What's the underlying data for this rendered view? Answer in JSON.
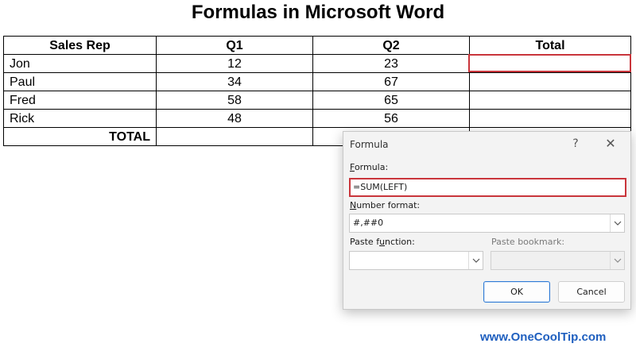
{
  "page": {
    "title": "Formulas in Microsoft Word"
  },
  "table": {
    "headers": [
      "Sales Rep",
      "Q1",
      "Q2",
      "Total"
    ],
    "rows": [
      {
        "rep": "Jon",
        "q1": "12",
        "q2": "23",
        "total": ""
      },
      {
        "rep": "Paul",
        "q1": "34",
        "q2": "67",
        "total": ""
      },
      {
        "rep": "Fred",
        "q1": "58",
        "q2": "65",
        "total": ""
      },
      {
        "rep": "Rick",
        "q1": "48",
        "q2": "56",
        "total": ""
      }
    ],
    "total_row_label": "TOTAL"
  },
  "dialog": {
    "title": "Formula",
    "help_glyph": "?",
    "close_glyph": "✕",
    "formula_label_hotkey": "F",
    "formula_label_rest": "ormula:",
    "formula_value": "=SUM(LEFT)",
    "number_format_label_hotkey": "N",
    "number_format_label_rest": "umber format:",
    "number_format_value": "#,##0",
    "paste_function_label_pre": "Paste f",
    "paste_function_label_hotkey": "u",
    "paste_function_label_post": "nction:",
    "paste_function_value": "",
    "paste_bookmark_label": "Paste bookmark:",
    "paste_bookmark_value": "",
    "ok_label": "OK",
    "cancel_label": "Cancel"
  },
  "watermark": "www.OneCoolTip.com",
  "colors": {
    "highlight": "#c9353b",
    "watermark": "#1f5fbf",
    "primary_button_border": "#2f7bd6"
  }
}
